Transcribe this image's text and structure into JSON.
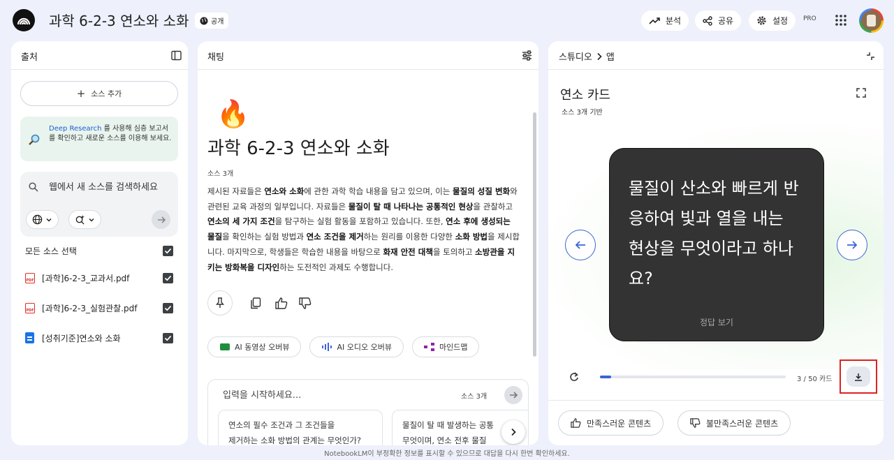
{
  "header": {
    "notebook_title": "과학 6-2-3 연소와 소화",
    "public_label": "공개",
    "analytics_label": "분석",
    "share_label": "공유",
    "settings_label": "설정",
    "pro_badge": "PRO"
  },
  "sources": {
    "title": "출처",
    "add_label": "소스 추가",
    "deep_research_link": "Deep Research",
    "deep_research_text": "를 사용해 심층 보고서를 확인하고 새로운 소스를 이용해 보세요.",
    "search_placeholder": "웹에서 새 소스를 검색하세요",
    "select_all_label": "모든 소스 선택",
    "items": [
      {
        "name": "[과학]6-2-3_교과서.pdf",
        "icon": "pdf-icon"
      },
      {
        "name": "[과학]6-2-3_실험관찰.pdf",
        "icon": "pdf-icon"
      },
      {
        "name": "[성취기준]연소와 소화",
        "icon": "document-icon"
      }
    ]
  },
  "chat": {
    "title": "채팅",
    "emoji": "🔥",
    "heading": "과학 6-2-3 연소와 소화",
    "source_count": "소스 3개",
    "summary": [
      {
        "t": "제시된 자료들은 "
      },
      {
        "t": "연소와 소화",
        "b": true
      },
      {
        "t": "에 관한 과학 학습 내용을 담고 있으며, 이는 "
      },
      {
        "t": "물질의 성질 변화",
        "b": true
      },
      {
        "t": "와 관련된 교육 과정의 일부입니다. 자료들은 "
      },
      {
        "t": "물질이 탈 때 나타나는 공통적인 현상",
        "b": true
      },
      {
        "t": "을 관찰하고 "
      },
      {
        "t": "연소의 세 가지 조건",
        "b": true
      },
      {
        "t": "을 탐구하는 실험 활동을 포함하고 있습니다. 또한, "
      },
      {
        "t": "연소 후에 생성되는 물질",
        "b": true
      },
      {
        "t": "을 확인하는 실험 방법과 "
      },
      {
        "t": "연소 조건을 제거",
        "b": true
      },
      {
        "t": "하는 원리를 이용한 다양한 "
      },
      {
        "t": "소화 방법",
        "b": true
      },
      {
        "t": "을 제시합니다. 마지막으로, 학생들은 학습한 내용을 바탕으로 "
      },
      {
        "t": "화재 안전 대책",
        "b": true
      },
      {
        "t": "을 토의하고 "
      },
      {
        "t": "소방관을 지키는 방화복을 디자인",
        "b": true
      },
      {
        "t": "하는 도전적인 과제도 수행합니다."
      }
    ],
    "chips": [
      "AI 동영상 오버뷰",
      "AI 오디오 오버뷰",
      "마인드맵"
    ],
    "composer_placeholder": "입력을 시작하세요...",
    "composer_source_count": "소스 3개",
    "suggestions": [
      [
        "연소의 필수 조건과 그 조건들을",
        "제거하는 소화 방법의 관계는 무엇인가?"
      ],
      [
        "물질이 탈 때 발생하는 공통",
        "무엇이며, 연소 전후 물질"
      ]
    ]
  },
  "studio": {
    "breadcrumb_root": "스튜디오",
    "breadcrumb_leaf": "앱",
    "card_title": "연소 카드",
    "card_subtitle": "소스 3개 기반",
    "question": "물질이 산소와 빠르게 반응하여 빛과 열을 내는 현상을 무엇이라고 하나요?",
    "answer_label": "정답 보기",
    "progress_text": "3 / 50 카드",
    "progress_fraction": 0.06,
    "good_content_label": "만족스러운 콘텐츠",
    "bad_content_label": "불만족스러운 콘텐츠",
    "accent_color": "#3b63d6"
  },
  "footer": {
    "disclaimer": "NotebookLM이 부정확한 정보를 표시할 수 있으므로 대답을 다시 한번 확인하세요."
  }
}
